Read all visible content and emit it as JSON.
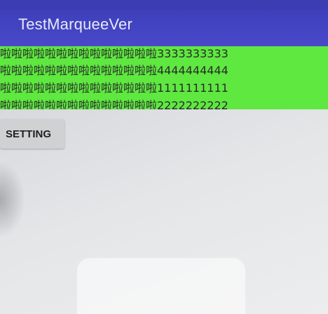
{
  "app_bar": {
    "title": "TestMarqueeVer"
  },
  "marquee": {
    "lines": [
      "啦啦啦啦啦啦啦啦啦啦啦啦啦啦3333333333",
      "啦啦啦啦啦啦啦啦啦啦啦啦啦啦4444444444",
      "啦啦啦啦啦啦啦啦啦啦啦啦啦啦1111111111",
      "啦啦啦啦啦啦啦啦啦啦啦啦啦啦2222222222"
    ]
  },
  "buttons": {
    "setting_label": "SETTING"
  },
  "colors": {
    "app_bar": "#4244c2",
    "marquee_background": "#5ee840"
  }
}
